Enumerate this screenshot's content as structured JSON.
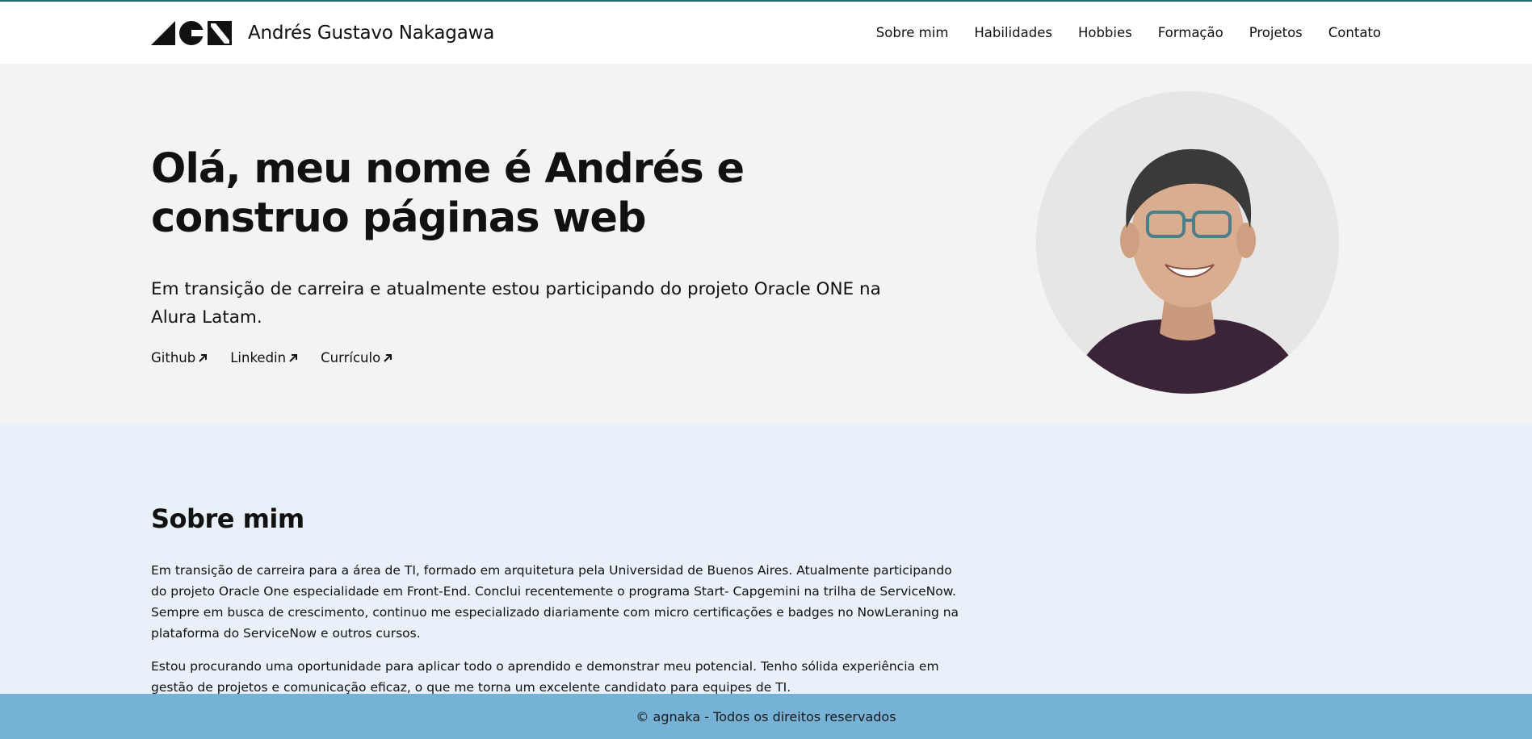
{
  "header": {
    "brand_name": "Andrés Gustavo Nakagawa",
    "nav": [
      "Sobre mim",
      "Habilidades",
      "Hobbies",
      "Formação",
      "Projetos",
      "Contato"
    ]
  },
  "hero": {
    "title": "Olá, meu nome é Andrés e construo páginas web",
    "subtitle": "Em transição de carreira e atualmente estou participando do projeto Oracle ONE na Alura Latam.",
    "links": [
      "Github",
      "Linkedin",
      "Currículo"
    ]
  },
  "about": {
    "title": "Sobre mim",
    "paragraphs": [
      "Em transição de carreira para a área de TI, formado em arquitetura pela Universidad de Buenos Aires. Atualmente participando do projeto Oracle One especialidade em Front-End. Conclui recentemente o programa Start- Capgemini na trilha de ServiceNow. Sempre em busca de crescimento, continuo me especializado diariamente com micro certificações e badges no NowLeraning na plataforma do ServiceNow e outros cursos.",
      "Estou procurando uma oportunidade para aplicar todo o aprendido e demonstrar meu potencial. Tenho sólida experiência em gestão de projetos e comunicação eficaz, o que me torna um excelente candidato para equipes de TI."
    ]
  },
  "footer": {
    "text": "© agnaka - Todos os direitos reservados"
  },
  "colors": {
    "header_line": "#1f6b73",
    "hero_bg": "#f3f3f3",
    "about_bg": "#e8f0fa",
    "footer_bg": "#75b2d6"
  },
  "icons": {
    "logo": "agn-logo-icon",
    "external_link": "arrow-up-right-icon",
    "avatar": "profile-photo"
  }
}
